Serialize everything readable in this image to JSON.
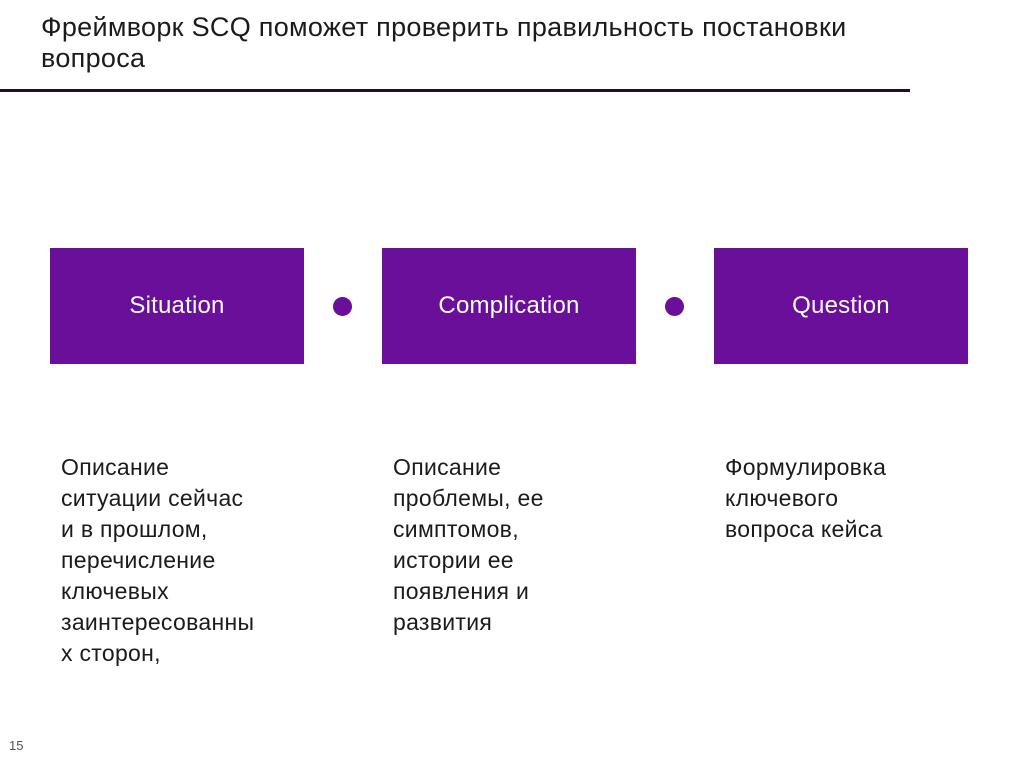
{
  "slide": {
    "title": "Фреймворк SCQ поможет проверить правильность постановки вопроса",
    "page_number": "15"
  },
  "steps": [
    {
      "label": "Situation",
      "description": "Описание\nситуации сейчас\nи в прошлом,\nперечисление\nключевых\nзаинтересованны\nх сторон,"
    },
    {
      "label": "Complication",
      "description": "Описание\nпроблемы, ее\nсимптомов,\nистории ее\nпоявления и\nразвития"
    },
    {
      "label": "Question",
      "description": "Формулировка\nключевого\nвопроса кейса"
    }
  ],
  "colors": {
    "accent": "#6a0f99",
    "rule": "#1f0f29",
    "text": "#1b1b1b"
  }
}
